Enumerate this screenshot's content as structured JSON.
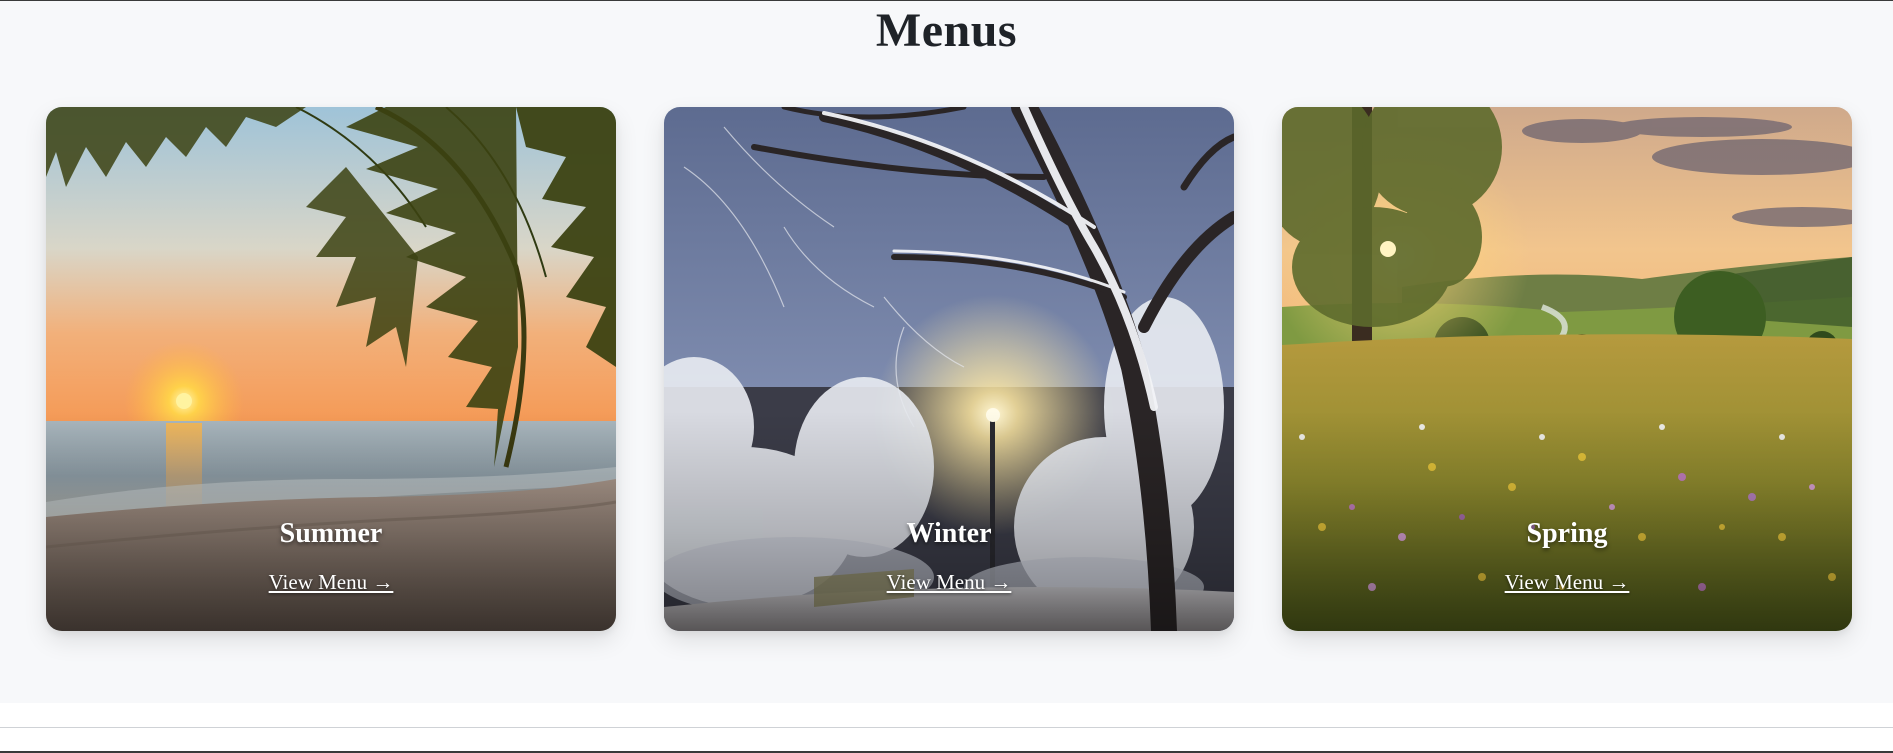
{
  "page": {
    "title": "Menus"
  },
  "cards": [
    {
      "title": "Summer",
      "link": "View Menu →",
      "icon": "beach-sunset-image"
    },
    {
      "title": "Winter",
      "link": "View Menu →",
      "icon": "snowy-park-image"
    },
    {
      "title": "Spring",
      "link": "View Menu →",
      "icon": "spring-meadow-image"
    }
  ],
  "colors": {
    "page_background": "#f7f8fa",
    "title_text": "#1f2328",
    "card_text": "#ffffff"
  }
}
